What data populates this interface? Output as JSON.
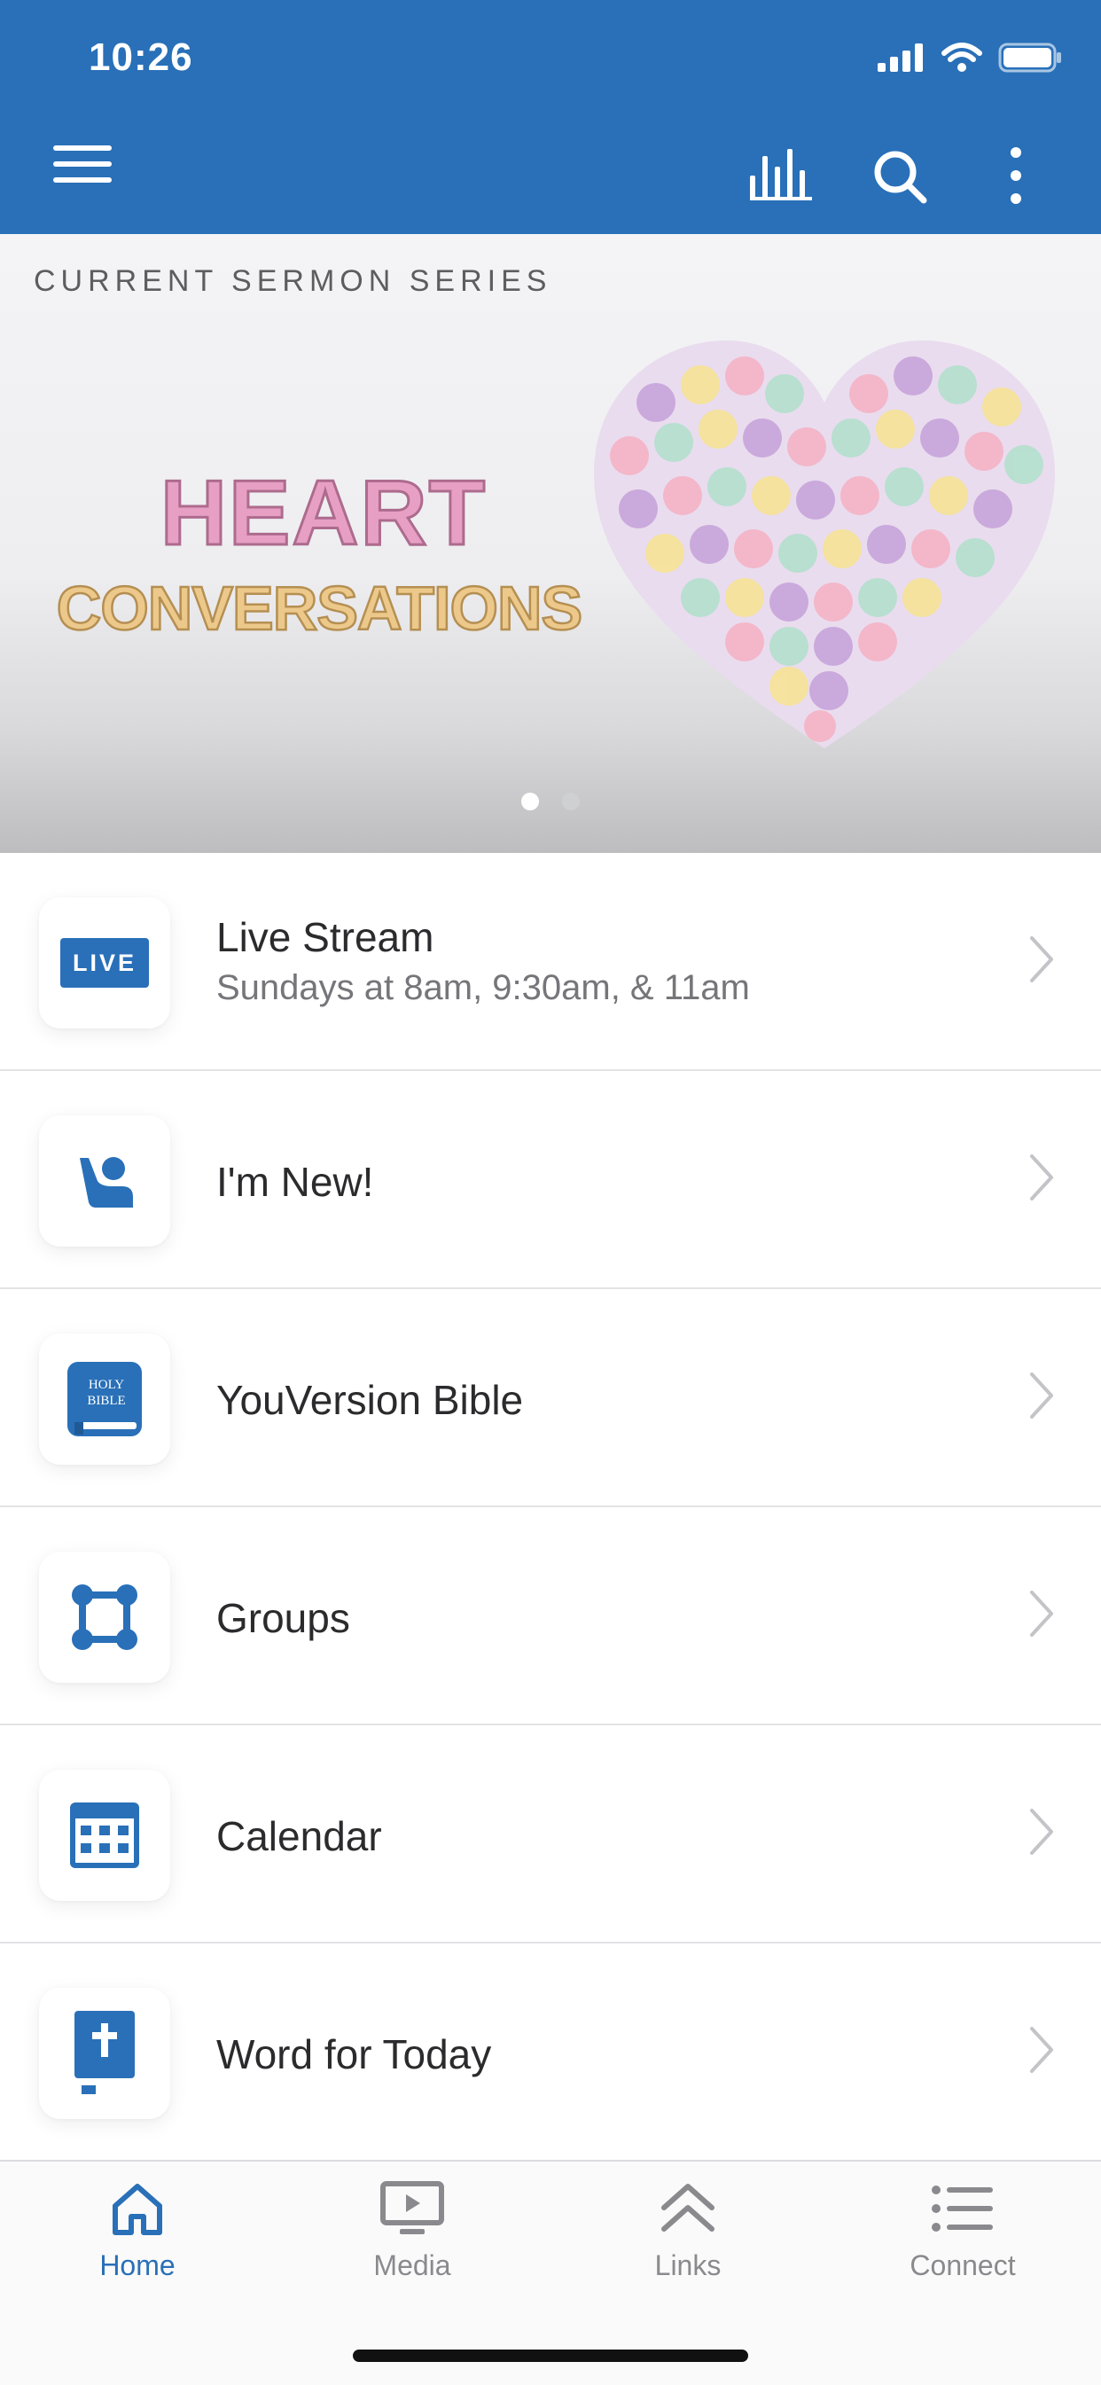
{
  "status": {
    "time": "10:26"
  },
  "toolbar": {
    "menu_icon": "hamburger-icon",
    "stats_icon": "bar-chart-icon",
    "search_icon": "search-icon",
    "more_icon": "more-vertical-icon"
  },
  "banner": {
    "label": "CURRENT SERMON SERIES",
    "title_line1": "HEART",
    "title_line2": "CONVERSATIONS",
    "pages": 2,
    "active_page": 1
  },
  "items": [
    {
      "title": "Live Stream",
      "subtitle": "Sundays at 8am, 9:30am, & 11am",
      "icon": "live-icon",
      "badge": "LIVE"
    },
    {
      "title": "I'm New!",
      "subtitle": "",
      "icon": "person-wave-icon"
    },
    {
      "title": "YouVersion Bible",
      "subtitle": "",
      "icon": "bible-icon",
      "book_text_1": "HOLY",
      "book_text_2": "BIBLE"
    },
    {
      "title": "Groups",
      "subtitle": "",
      "icon": "groups-icon"
    },
    {
      "title": "Calendar",
      "subtitle": "",
      "icon": "calendar-icon"
    },
    {
      "title": "Word for Today",
      "subtitle": "",
      "icon": "devotional-book-icon"
    }
  ],
  "tabs": [
    {
      "label": "Home",
      "icon": "home-icon",
      "active": true
    },
    {
      "label": "Media",
      "icon": "media-icon",
      "active": false
    },
    {
      "label": "Links",
      "icon": "links-icon",
      "active": false
    },
    {
      "label": "Connect",
      "icon": "connect-icon",
      "active": false
    }
  ],
  "colors": {
    "brand": "#2970b8",
    "text": "#2b2b2d",
    "subtext": "#75757a",
    "inactive_tab": "#8a8a8e"
  }
}
